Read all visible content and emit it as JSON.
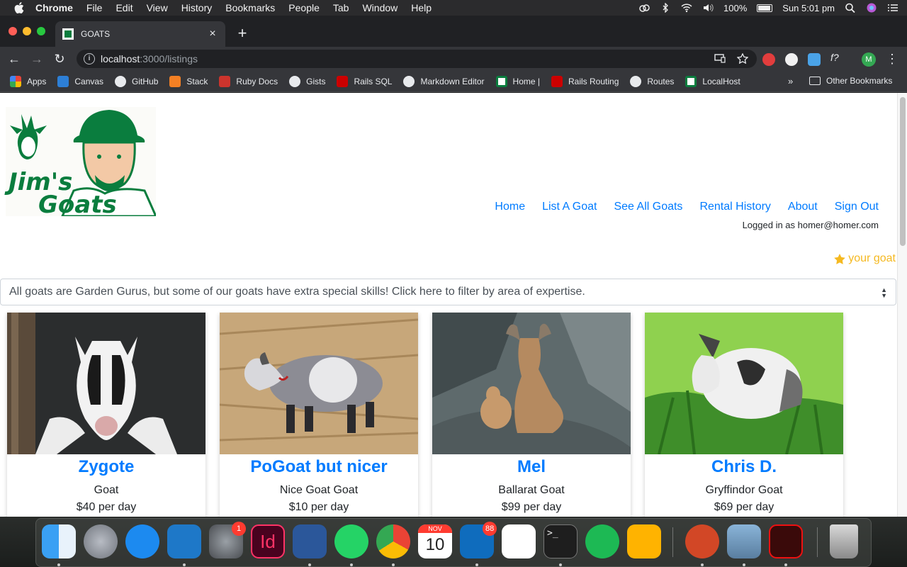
{
  "menubar": {
    "app": "Chrome",
    "items": [
      "File",
      "Edit",
      "View",
      "History",
      "Bookmarks",
      "People",
      "Tab",
      "Window",
      "Help"
    ],
    "battery": "100%",
    "clock": "Sun 5:01 pm"
  },
  "tab": {
    "title": "GOATS"
  },
  "address": {
    "host": "localhost",
    "path": ":3000/listings"
  },
  "bookmarks": [
    {
      "label": "Apps",
      "color": "#e8453c"
    },
    {
      "label": "Canvas",
      "color": "#e4292a"
    },
    {
      "label": "GitHub",
      "color": "#ffffff"
    },
    {
      "label": "Stack",
      "color": "#f48024"
    },
    {
      "label": "Ruby Docs",
      "color": "#cc342d"
    },
    {
      "label": "Gists",
      "color": "#ffffff"
    },
    {
      "label": "Rails SQL",
      "color": "#cc0000"
    },
    {
      "label": "Markdown Editor",
      "color": "#ffffff"
    },
    {
      "label": "Home |",
      "color": "#0a7d3e"
    },
    {
      "label": "Rails Routing",
      "color": "#cc0000"
    },
    {
      "label": "Routes",
      "color": "#ffffff"
    },
    {
      "label": "LocalHost",
      "color": "#0a7d3e"
    }
  ],
  "bookmarks_more": "»",
  "other_bookmarks": "Other Bookmarks",
  "site": {
    "logo_line1": "Jim's",
    "logo_line2": "Goats",
    "nav": [
      "Home",
      "List A Goat",
      "See All Goats",
      "Rental History",
      "About",
      "Sign Out"
    ],
    "logged_in": "Logged in as homer@homer.com",
    "your_goat": "your goat",
    "filter_text": "All goats are Garden Gurus, but some of our goats have extra special skills! Click here to filter by area of expertise.",
    "cards": [
      {
        "name": "Zygote",
        "breed": "Goat",
        "price": "$40 per day"
      },
      {
        "name": "PoGoat but nicer",
        "breed": "Nice Goat Goat",
        "price": "$10 per day"
      },
      {
        "name": "Mel",
        "breed": "Ballarat Goat",
        "price": "$99 per day"
      },
      {
        "name": "Chris D.",
        "breed": "Gryffindor Goat",
        "price": "$69 per day"
      }
    ]
  },
  "dock": {
    "badges": {
      "prefs": "1",
      "outlook": "88"
    },
    "calendar": {
      "month": "NOV",
      "day": "10"
    },
    "apps": [
      "finder-icon",
      "launchpad-icon",
      "app-store-icon",
      "vscode-icon",
      "system-preferences-icon",
      "indesign-icon",
      "word-icon",
      "whatsapp-icon",
      "chrome-icon",
      "calendar-icon",
      "outlook-icon",
      "slack-icon",
      "terminal-icon",
      "spotify-icon",
      "vlc-icon",
      "powerpoint-icon",
      "preview-icon",
      "acrobat-icon",
      "trash-icon"
    ]
  },
  "colors": {
    "brand_green": "#0a7d3e",
    "link_blue": "#007bff",
    "star_gold": "#f5b921"
  }
}
